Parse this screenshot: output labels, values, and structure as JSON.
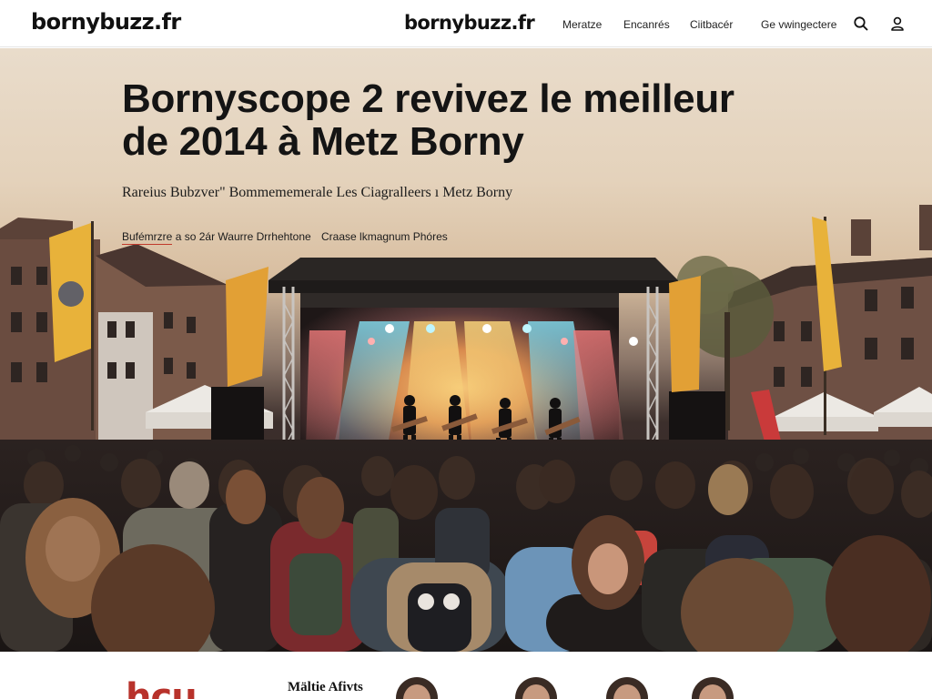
{
  "header": {
    "logo_left": "bornybuzz.fr",
    "logo_center": "bornybuzz.fr",
    "nav": [
      {
        "label": "Meratze"
      },
      {
        "label": "Encanrés"
      },
      {
        "label": "Ciitbacér"
      },
      {
        "label": "Ge vwingectere"
      }
    ],
    "icons": [
      "search-icon",
      "user-icon"
    ]
  },
  "hero": {
    "title": "Bornyscope 2 revivez le meilleur de 2014 à Metz Borny",
    "subtitle": "Rareius Bubzver\" Bommememerale Les Ciagralleers ı Metz Borny",
    "credit_author": "Bufémrzre",
    "credit_rest": "a so 2ár Waurre Drrhehtone",
    "credit_photo": "Craase lkmagnum Phóres"
  },
  "below": {
    "brand_fragment": "hcu",
    "section_title": "Mältie Afivts"
  },
  "colors": {
    "accent": "#b8322b",
    "header_bg": "#ffffff",
    "banner_yellow": "#e8b23a"
  }
}
